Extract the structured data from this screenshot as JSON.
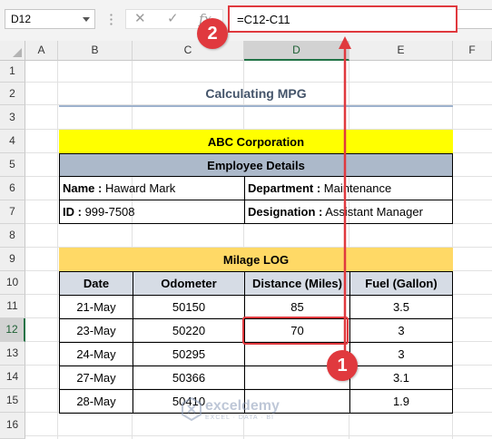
{
  "formula_bar": {
    "name_box": "D12",
    "cancel_icon": "✕",
    "enter_icon": "✓",
    "fx_label": "fx",
    "formula": "=C12-C11"
  },
  "columns": [
    "A",
    "B",
    "C",
    "D",
    "E",
    "F"
  ],
  "rows": [
    "1",
    "2",
    "3",
    "4",
    "5",
    "6",
    "7",
    "8",
    "9",
    "10",
    "11",
    "12",
    "13",
    "14",
    "15",
    "16"
  ],
  "selected_cell": {
    "column": "D",
    "row": "12"
  },
  "sheet": {
    "title": "Calculating MPG",
    "company": "ABC Corporation",
    "employee_header": "Employee Details",
    "name_label": "Name :",
    "name_value": " Haward Mark",
    "department_label": "Department :",
    "department_value": " Maintenance",
    "id_label": "ID :",
    "id_value": " 999-7508",
    "designation_label": "Designation :",
    "designation_value": " Assistant Manager",
    "log_title": "Milage LOG",
    "headers": [
      "Date",
      "Odometer",
      "Distance (Miles)",
      "Fuel (Gallon)"
    ],
    "log_rows": [
      [
        "21-May",
        "50150",
        "85",
        "3.5"
      ],
      [
        "23-May",
        "50220",
        "70",
        "3"
      ],
      [
        "24-May",
        "50295",
        "",
        "3"
      ],
      [
        "27-May",
        "50366",
        "",
        "3.1"
      ],
      [
        "28-May",
        "50410",
        "",
        "1.9"
      ]
    ]
  },
  "annotations": {
    "badge_1": "1",
    "badge_2": "2"
  },
  "watermark": {
    "name": "exceldemy",
    "tagline": "EXCEL · DATA · BI"
  },
  "colors": {
    "accent": "#e0393e",
    "excel_green": "#217346",
    "company_bg": "#ffff00",
    "log_bg": "#ffd966",
    "employee_bg": "#acb9ca"
  }
}
